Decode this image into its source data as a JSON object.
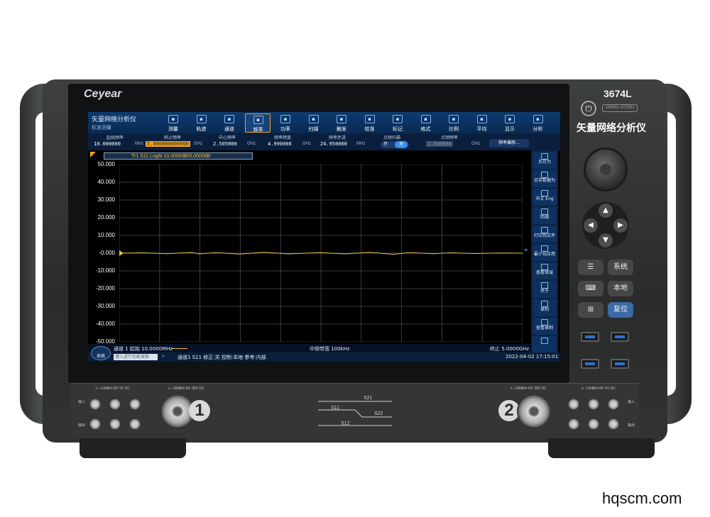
{
  "device": {
    "brand": "Ceyear",
    "model": "3674L",
    "freq_range": "10MHz–67GHz",
    "panel_title": "矢量网络分析仪",
    "power_icon": "power-icon"
  },
  "app": {
    "title": "矢量网络分析仪",
    "subtitle": "标准测量"
  },
  "menu": [
    {
      "label": "测量",
      "icon": "measure-icon"
    },
    {
      "label": "轨迹",
      "icon": "trace-icon"
    },
    {
      "label": "通道",
      "icon": "channel-icon"
    },
    {
      "label": "频率",
      "icon": "frequency-icon",
      "active": true
    },
    {
      "label": "功率",
      "icon": "power-level-icon"
    },
    {
      "label": "扫描",
      "icon": "sweep-icon"
    },
    {
      "label": "触发",
      "icon": "trigger-icon"
    },
    {
      "label": "校准",
      "icon": "calibration-icon"
    },
    {
      "label": "标记",
      "icon": "marker-icon"
    },
    {
      "label": "格式",
      "icon": "format-icon"
    },
    {
      "label": "比例",
      "icon": "scale-icon"
    },
    {
      "label": "平均",
      "icon": "average-icon"
    },
    {
      "label": "显示",
      "icon": "display-icon"
    },
    {
      "label": "分析",
      "icon": "analysis-icon"
    }
  ],
  "params": {
    "start": {
      "label": "起始频率",
      "value": "10.000000",
      "unit": "MHz"
    },
    "stop": {
      "label": "终止频率",
      "value": "5.000000000000",
      "unit": "GHz"
    },
    "center": {
      "label": "中心频率",
      "value": "2.505000",
      "unit": "GHz"
    },
    "span": {
      "label": "频率跨度",
      "value": "4.990000",
      "unit": "GHz"
    },
    "step": {
      "label": "频率步进",
      "value": "24.950000",
      "unit": "MHz"
    },
    "cw_sweep": {
      "label": "点频扫描",
      "on": "开",
      "off": "关"
    },
    "cw_freq": {
      "label": "点频频率",
      "value": "2.500000",
      "unit": "GHz"
    },
    "offset_button": "频率偏移..."
  },
  "trace_tag": "Tr1  S11  LogM 10.0000dB/0.0000dB",
  "y_ticks": [
    "50.000",
    "40.000",
    "30.000",
    "20.000",
    "10.000",
    "-0.000",
    "-10.000",
    "-20.000",
    "-30.000",
    "-40.000",
    "-50.000"
  ],
  "chart_data": {
    "type": "line",
    "ylim": [
      -50,
      50
    ],
    "y_unit": "dB",
    "x_start_mhz": 10,
    "x_stop_mhz": 5000,
    "grid": true,
    "series": [
      {
        "name": "Tr1 S11",
        "color": "#e8c84a",
        "x_mhz": [
          10,
          300,
          600,
          900,
          1000,
          1200,
          1500,
          1800,
          2100,
          2500,
          2800,
          3100,
          3400,
          3600,
          3900,
          4100,
          4400,
          4700,
          5000
        ],
        "values": [
          0.0,
          0.2,
          -0.3,
          0.4,
          -0.4,
          0.3,
          -0.5,
          0.5,
          -0.4,
          0.3,
          -0.4,
          0.5,
          -0.6,
          0.3,
          -0.3,
          0.2,
          -0.2,
          0.1,
          0.0
        ]
      }
    ]
  },
  "sidebar": [
    {
      "label": "另存为",
      "icon": "save-as-icon"
    },
    {
      "label": "另存数据为",
      "icon": "save-data-icon"
    },
    {
      "label": "中文 Eng",
      "icon": "language-icon"
    },
    {
      "label": "回调",
      "icon": "recall-icon"
    },
    {
      "label": "打印到文件",
      "icon": "print-icon"
    },
    {
      "label": "最小化应用",
      "icon": "minimize-icon"
    },
    {
      "label": "查看错误",
      "icon": "error-log-icon"
    },
    {
      "label": "关于",
      "icon": "about-icon"
    },
    {
      "label": "录制",
      "icon": "record-icon"
    },
    {
      "label": "查看录制",
      "icon": "view-record-icon"
    },
    {
      "label": "",
      "icon": "close-x-icon"
    }
  ],
  "status": {
    "channel_start": "通道 1  起始 10.0000MHz",
    "if_bw": "中频带宽 100kHz",
    "stop": "终止 5.0000GHz",
    "system_button": "系统",
    "search_placeholder": "键入进行功能搜索",
    "info": "通道1  S11  修正:关  控制:本地  参考:内部",
    "datetime": "2022-04-02  17:15:01"
  },
  "front_keys": {
    "system": "系统",
    "local": "本地",
    "preset": "复位"
  },
  "ports": {
    "warn_1a": "⚠ +15dBm RF 5V DC",
    "warn_1b": "⚠ +30dBm RF 30V DC",
    "warn_2a": "⚠ +30dBm RF 30V DC",
    "warn_2b": "⚠ +15dBm RF 5V DC",
    "in": "输入",
    "out": "输出",
    "port1": "1",
    "port2": "2",
    "s21": "S21",
    "s11": "S11",
    "s22": "S22",
    "s12": "S12"
  },
  "watermark": "hqscm.com"
}
